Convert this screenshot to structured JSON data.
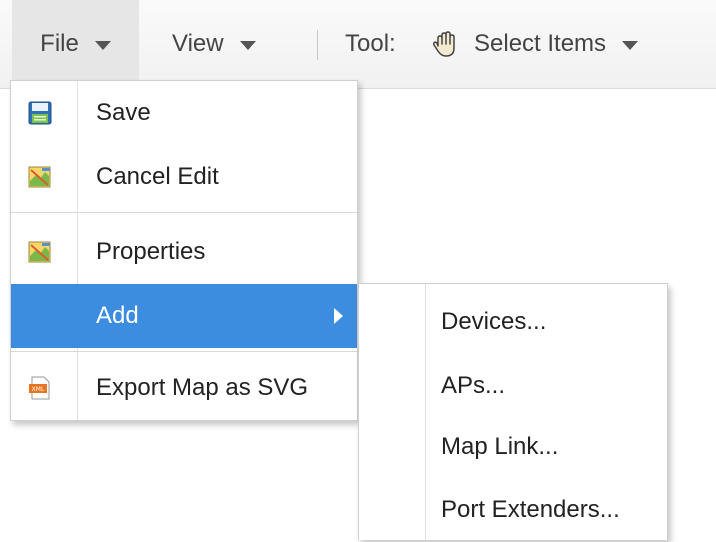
{
  "toolbar": {
    "file_label": "File",
    "view_label": "View",
    "tool_label": "Tool:",
    "select_label": "Select Items",
    "select_icon": "hand-icon"
  },
  "file_menu": {
    "items": [
      {
        "label": "Save",
        "icon": "save-icon"
      },
      {
        "label": "Cancel Edit",
        "icon": "map-edit-icon"
      },
      {
        "label": "Properties",
        "icon": "map-edit-icon"
      },
      {
        "label": "Add",
        "icon": "",
        "has_submenu": true,
        "highlighted": true
      },
      {
        "label": "Export Map as SVG",
        "icon": "xml-export-icon"
      }
    ]
  },
  "add_submenu": {
    "items": [
      {
        "label": "Devices..."
      },
      {
        "label": "APs..."
      },
      {
        "label": "Map Link..."
      },
      {
        "label": "Port Extenders..."
      }
    ]
  },
  "colors": {
    "highlight": "#3c8ddf",
    "toolbar_bg": "#f1f1f1",
    "active_tab_bg": "#e6e6e6"
  }
}
